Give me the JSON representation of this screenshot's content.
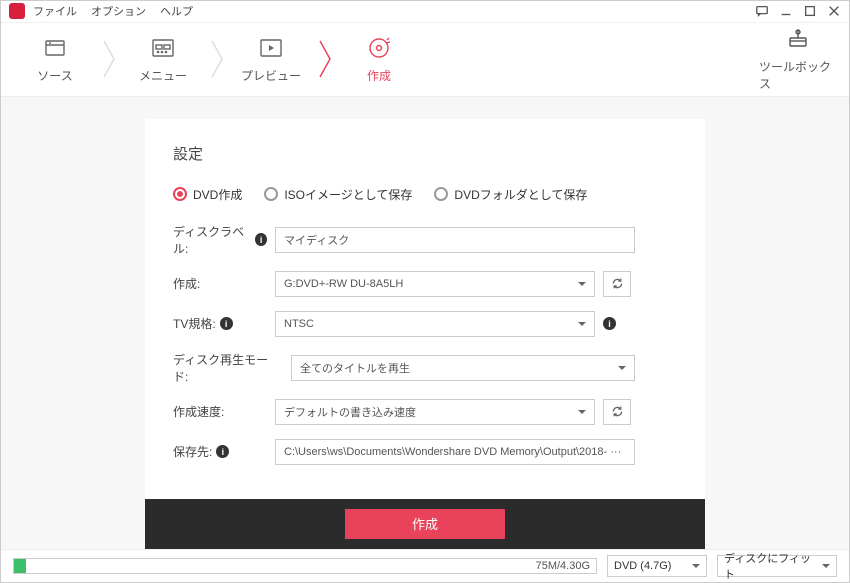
{
  "menubar": {
    "file": "ファイル",
    "option": "オプション",
    "help": "ヘルプ"
  },
  "steps": {
    "source": "ソース",
    "menu": "メニュー",
    "preview": "プレビュー",
    "create": "作成"
  },
  "toolbox_label": "ツールボックス",
  "panel": {
    "title": "設定",
    "radios": {
      "dvd": "DVD作成",
      "iso": "ISOイメージとして保存",
      "folder": "DVDフォルダとして保存"
    },
    "labels": {
      "disc_label": "ディスクラベル:",
      "create": "作成:",
      "tv": "TV規格:",
      "playback": "ディスク再生モード:",
      "speed": "作成速度:",
      "saveto": "保存先:"
    },
    "values": {
      "disc_label": "マイディスク",
      "create": "G:DVD+-RW DU-8A5LH",
      "tv": "NTSC",
      "playback": "全てのタイトルを再生",
      "speed": "デフォルトの書き込み速度",
      "saveto": "C:\\Users\\ws\\Documents\\Wondershare DVD Memory\\Output\\2018-  ···"
    }
  },
  "burn_button": "作成",
  "status": {
    "progress_text": "75M/4.30G",
    "dvd_select": "DVD (4.7G)",
    "fit_select": "ディスクにフィット"
  }
}
